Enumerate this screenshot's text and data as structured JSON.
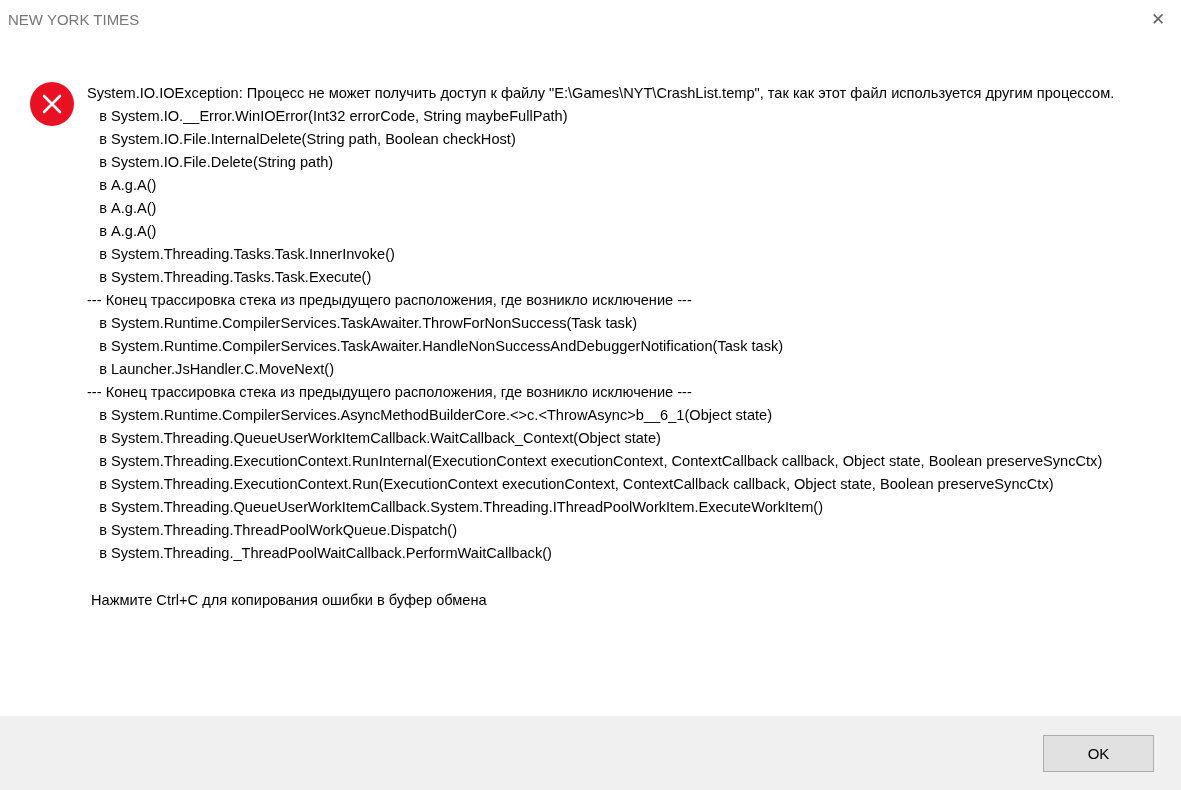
{
  "window": {
    "title": "NEW YORK TIMES",
    "close": "✕"
  },
  "message": {
    "lines": [
      "System.IO.IOException: Процесс не может получить доступ к файлу \"E:\\Games\\NYT\\CrashList.temp\", так как этот файл используется другим процессом.",
      "   в System.IO.__Error.WinIOError(Int32 errorCode, String maybeFullPath)",
      "   в System.IO.File.InternalDelete(String path, Boolean checkHost)",
      "   в System.IO.File.Delete(String path)",
      "   в A.g.A()",
      "   в A.g.A()",
      "   в A.g.A()",
      "   в System.Threading.Tasks.Task.InnerInvoke()",
      "   в System.Threading.Tasks.Task.Execute()",
      "--- Конец трассировка стека из предыдущего расположения, где возникло исключение ---",
      "   в System.Runtime.CompilerServices.TaskAwaiter.ThrowForNonSuccess(Task task)",
      "   в System.Runtime.CompilerServices.TaskAwaiter.HandleNonSuccessAndDebuggerNotification(Task task)",
      "   в Launcher.JsHandler.C.MoveNext()",
      "--- Конец трассировка стека из предыдущего расположения, где возникло исключение ---",
      "   в System.Runtime.CompilerServices.AsyncMethodBuilderCore.<>c.<ThrowAsync>b__6_1(Object state)",
      "   в System.Threading.QueueUserWorkItemCallback.WaitCallback_Context(Object state)",
      "   в System.Threading.ExecutionContext.RunInternal(ExecutionContext executionContext, ContextCallback callback, Object state, Boolean preserveSyncCtx)",
      "   в System.Threading.ExecutionContext.Run(ExecutionContext executionContext, ContextCallback callback, Object state, Boolean preserveSyncCtx)",
      "   в System.Threading.QueueUserWorkItemCallback.System.Threading.IThreadPoolWorkItem.ExecuteWorkItem()",
      "   в System.Threading.ThreadPoolWorkQueue.Dispatch()",
      "   в System.Threading._ThreadPoolWaitCallback.PerformWaitCallback()"
    ],
    "hint": " Нажмите Ctrl+C для копирования ошибки в буфер обмена"
  },
  "buttons": [
    {
      "label": "OK"
    }
  ]
}
